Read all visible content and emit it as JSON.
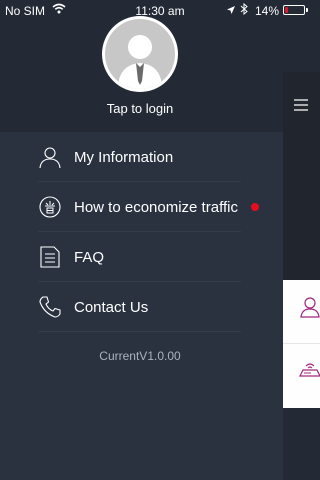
{
  "status_bar": {
    "carrier": "No SIM",
    "time": "11:30 am",
    "battery_percent": "14%",
    "battery_level": 0.14,
    "battery_color": "#e0162b",
    "icons": [
      "wifi-icon",
      "location-arrow-icon",
      "bluetooth-icon",
      "battery-icon"
    ]
  },
  "profile": {
    "login_label": "Tap to login"
  },
  "menu": {
    "items": [
      {
        "label": "My Information",
        "icon": "person-icon"
      },
      {
        "label": "How to economize traffic",
        "icon": "save-traffic-icon",
        "badge": "red-dot"
      },
      {
        "label": "FAQ",
        "icon": "document-icon"
      },
      {
        "label": "Contact Us",
        "icon": "phone-icon"
      }
    ],
    "version": "CurrentV1.0.00"
  },
  "content_panel": {
    "icons": [
      "hamburger-menu-icon",
      "user-icon",
      "router-icon"
    ],
    "accent_color": "#a02a7c"
  }
}
